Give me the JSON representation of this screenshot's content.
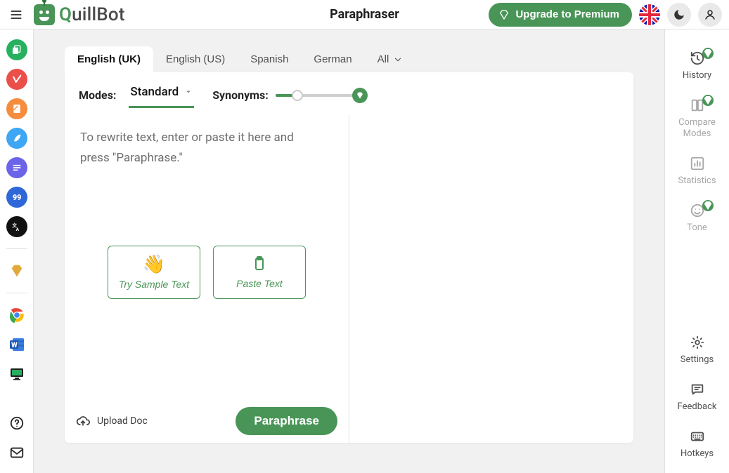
{
  "app": {
    "title": "Paraphraser",
    "logo": {
      "q": "Q",
      "rest": "uillBot"
    },
    "upgrade_label": "Upgrade to Premium",
    "language_flag": "en-GB"
  },
  "rail": {
    "items": [
      {
        "name": "paraphraser",
        "icon": "copy-icon",
        "color": "green"
      },
      {
        "name": "grammar-checker",
        "icon": "check-badge-icon",
        "color": "red"
      },
      {
        "name": "plagiarism-checker",
        "icon": "scan-icon",
        "color": "orange"
      },
      {
        "name": "cowriter",
        "icon": "feather-icon",
        "color": "sky"
      },
      {
        "name": "summarizer",
        "icon": "lines-icon",
        "color": "purple"
      },
      {
        "name": "citation-generator",
        "icon": "quote-icon",
        "color": "blue"
      },
      {
        "name": "translator",
        "icon": "translate-icon",
        "color": "black"
      }
    ],
    "premium_icon": "diamond-icon",
    "extensions": [
      {
        "name": "chrome-extension",
        "icon": "chrome-icon"
      },
      {
        "name": "word-extension",
        "icon": "word-icon"
      },
      {
        "name": "macos-extension",
        "icon": "desktop-icon"
      }
    ],
    "bottom": [
      {
        "name": "help",
        "icon": "help-icon"
      },
      {
        "name": "contact",
        "icon": "mail-icon"
      }
    ]
  },
  "tabs": {
    "items": [
      {
        "id": "en-uk",
        "label": "English (UK)",
        "active": true
      },
      {
        "id": "en-us",
        "label": "English (US)",
        "active": false
      },
      {
        "id": "es",
        "label": "Spanish",
        "active": false
      },
      {
        "id": "de",
        "label": "German",
        "active": false
      },
      {
        "id": "all",
        "label": "All",
        "active": false,
        "dropdown": true
      }
    ]
  },
  "toolbar": {
    "modes_label": "Modes:",
    "mode_selected": "Standard",
    "synonyms_label": "Synonyms:",
    "synonyms_pct": 28
  },
  "editor": {
    "placeholder": "To rewrite text, enter or paste it here and press \"Paraphrase.\"",
    "sample_label": "Try Sample Text",
    "paste_label": "Paste Text",
    "upload_label": "Upload Doc",
    "paraphrase_label": "Paraphrase"
  },
  "sidepanel": {
    "items": [
      {
        "id": "history",
        "label": "History",
        "premium": true,
        "faint": false
      },
      {
        "id": "compare",
        "label": "Compare Modes",
        "premium": true,
        "faint": true
      },
      {
        "id": "statistics",
        "label": "Statistics",
        "premium": false,
        "faint": true
      },
      {
        "id": "tone",
        "label": "Tone",
        "premium": true,
        "faint": true
      }
    ],
    "bottom": [
      {
        "id": "settings",
        "label": "Settings"
      },
      {
        "id": "feedback",
        "label": "Feedback"
      },
      {
        "id": "hotkeys",
        "label": "Hotkeys"
      }
    ]
  }
}
